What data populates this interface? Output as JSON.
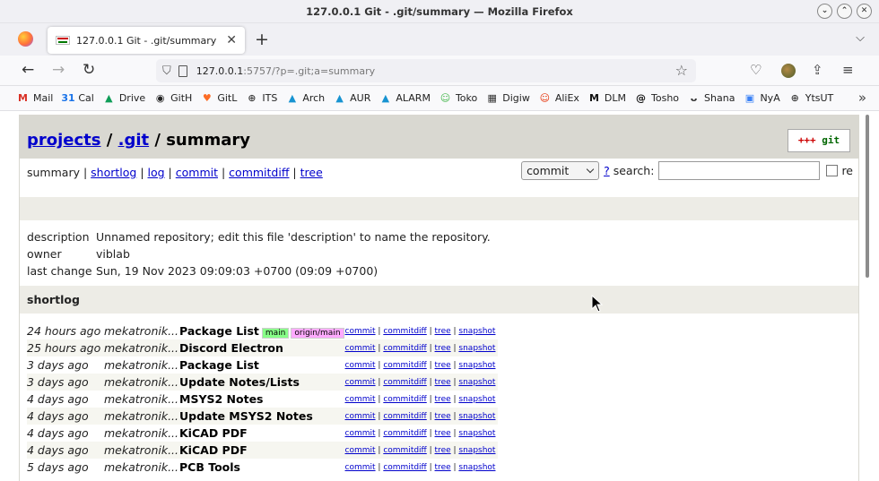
{
  "window": {
    "title": "127.0.0.1 Git - .git/summary — Mozilla Firefox"
  },
  "tab": {
    "title": "127.0.0.1 Git - .git/summary"
  },
  "nav": {
    "url_host": "127.0.0.1",
    "url_rest": ":5757/?p=.git;a=summary"
  },
  "bookmarks": [
    {
      "label": "Mail",
      "icon": "gmail-icon",
      "color": "#d93025",
      "glyph": "M"
    },
    {
      "label": "Cal",
      "icon": "calendar-icon",
      "color": "#1a73e8",
      "glyph": "31"
    },
    {
      "label": "Drive",
      "icon": "drive-icon",
      "color": "#0f9d58",
      "glyph": "▲"
    },
    {
      "label": "GitH",
      "icon": "github-icon",
      "color": "#222222",
      "glyph": "◉"
    },
    {
      "label": "GitL",
      "icon": "gitlab-icon",
      "color": "#fc6d26",
      "glyph": "♥"
    },
    {
      "label": "ITS",
      "icon": "globe-icon",
      "color": "#444444",
      "glyph": "⊕"
    },
    {
      "label": "Arch",
      "icon": "arch-icon",
      "color": "#1793d1",
      "glyph": "▲"
    },
    {
      "label": "AUR",
      "icon": "arch-icon",
      "color": "#1793d1",
      "glyph": "▲"
    },
    {
      "label": "ALARM",
      "icon": "arch-icon",
      "color": "#1793d1",
      "glyph": "▲"
    },
    {
      "label": "Toko",
      "icon": "tokopedia-icon",
      "color": "#42b549",
      "glyph": "☺"
    },
    {
      "label": "Digiw",
      "icon": "digiware-icon",
      "color": "#333333",
      "glyph": "▦"
    },
    {
      "label": "AliEx",
      "icon": "aliexpress-icon",
      "color": "#e62e04",
      "glyph": "☺"
    },
    {
      "label": "DLM",
      "icon": "dlm-icon",
      "color": "#111111",
      "glyph": "M"
    },
    {
      "label": "Tosho",
      "icon": "at-icon",
      "color": "#111111",
      "glyph": "@"
    },
    {
      "label": "Shana",
      "icon": "shana-icon",
      "color": "#333333",
      "glyph": "ᴗ"
    },
    {
      "label": "NyA",
      "icon": "nya-icon",
      "color": "#3b82f6",
      "glyph": "▣"
    },
    {
      "label": "YtsUT",
      "icon": "globe-icon",
      "color": "#444444",
      "glyph": "⊕"
    }
  ],
  "page": {
    "projects_link": "projects",
    "sep1": " / ",
    "repo_link": ".git",
    "sep2": " / summary",
    "git_logo_red": "+++",
    "git_logo_green": " git",
    "nav_summary": "summary",
    "nav_links": [
      "shortlog",
      "log",
      "commit",
      "commitdiff",
      "tree"
    ],
    "search_select": "commit",
    "help_link": "?",
    "search_label": "search:",
    "re_label": "re",
    "project_info": [
      {
        "key": "description",
        "value": "Unnamed repository; edit this file 'description' to name the repository."
      },
      {
        "key": "owner",
        "value": "viblab"
      },
      {
        "key": "last change",
        "value": "Sun, 19 Nov 2023 09:09:03 +0700 (09:09 +0700)"
      }
    ],
    "shortlog_title": "shortlog",
    "action_links": [
      "commit",
      "commitdiff",
      "tree",
      "snapshot"
    ],
    "commits": [
      {
        "age": "24 hours ago",
        "author": "mekatronik...",
        "subject": "Package List",
        "tags": [
          "main",
          "origin/main"
        ]
      },
      {
        "age": "25 hours ago",
        "author": "mekatronik...",
        "subject": "Discord Electron",
        "tags": []
      },
      {
        "age": "3 days ago",
        "author": "mekatronik...",
        "subject": "Package List",
        "tags": []
      },
      {
        "age": "3 days ago",
        "author": "mekatronik...",
        "subject": "Update Notes/Lists",
        "tags": []
      },
      {
        "age": "4 days ago",
        "author": "mekatronik...",
        "subject": "MSYS2 Notes",
        "tags": []
      },
      {
        "age": "4 days ago",
        "author": "mekatronik...",
        "subject": "Update MSYS2 Notes",
        "tags": []
      },
      {
        "age": "4 days ago",
        "author": "mekatronik...",
        "subject": "KiCAD PDF",
        "tags": []
      },
      {
        "age": "4 days ago",
        "author": "mekatronik...",
        "subject": "KiCAD PDF",
        "tags": []
      },
      {
        "age": "5 days ago",
        "author": "mekatronik...",
        "subject": "PCB Tools",
        "tags": []
      }
    ]
  }
}
